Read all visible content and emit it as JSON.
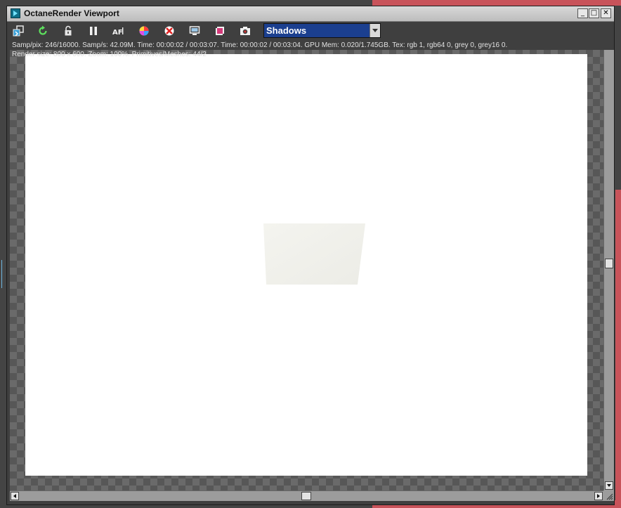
{
  "window": {
    "title": "OctaneRender Viewport",
    "controls": {
      "minimize": "_",
      "maximize": "□",
      "close": "✕"
    }
  },
  "toolbar": {
    "buttons": [
      {
        "name": "send-scene-icon"
      },
      {
        "name": "restart-render-icon"
      },
      {
        "name": "lock-icon"
      },
      {
        "name": "pause-icon"
      },
      {
        "name": "auto-focus-icon",
        "glyph": "AF"
      },
      {
        "name": "color-picker-icon"
      },
      {
        "name": "clear-render-icon"
      },
      {
        "name": "display-settings-icon"
      },
      {
        "name": "region-render-icon"
      },
      {
        "name": "camera-icon"
      }
    ],
    "render_mode": {
      "selected": "Shadows"
    }
  },
  "status": {
    "line1": "Samp/pix: 246/16000.   Samp/s: 42.09M.   Time: 00:00:02 / 00:03:07.   Time: 00:00:02 / 00:03:04.   GPU Mem: 0.020/1.745GB.   Tex: rgb 1, rgb64 0, grey 0, grey16 0.",
    "line2": "Render size: 800 x 600.   Zoom: 100%.   Primitives/Meshes: 44/2"
  },
  "colors": {
    "dropdown_bg": "#1b3f8f",
    "render_bg": "#ffffff",
    "background_accent": "#c8535a"
  }
}
